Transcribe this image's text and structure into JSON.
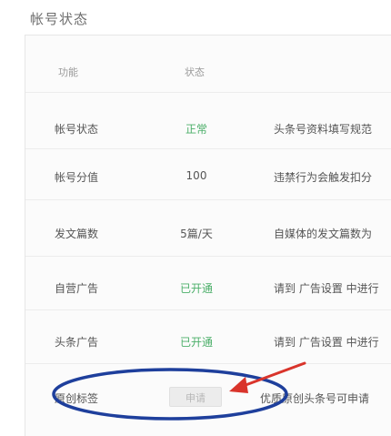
{
  "section_title": "帐号状态",
  "table": {
    "headers": {
      "feature": "功能",
      "status": "状态"
    },
    "rows": [
      {
        "feature": "帐号状态",
        "status": "正常",
        "status_color": "#4caf6a",
        "desc": "头条号资料填写规范"
      },
      {
        "feature": "帐号分值",
        "status": "100",
        "status_color": "#555555",
        "desc": "违禁行为会触发扣分"
      },
      {
        "feature": "发文篇数",
        "status": "5篇/天",
        "status_color": "#555555",
        "desc": "自媒体的发文篇数为"
      },
      {
        "feature": "自营广告",
        "status": "已开通",
        "status_color": "#4caf6a",
        "desc": "请到 广告设置 中进行"
      },
      {
        "feature": "头条广告",
        "status": "已开通",
        "status_color": "#4caf6a",
        "desc": "请到 广告设置 中进行"
      },
      {
        "feature": "原创标签",
        "status": "申请",
        "status_color": "#b7b7b7",
        "desc": "优质原创头条号可申请"
      }
    ]
  },
  "annotation_colors": {
    "ellipse": "#1e3f9c",
    "arrow": "#d9342b"
  }
}
